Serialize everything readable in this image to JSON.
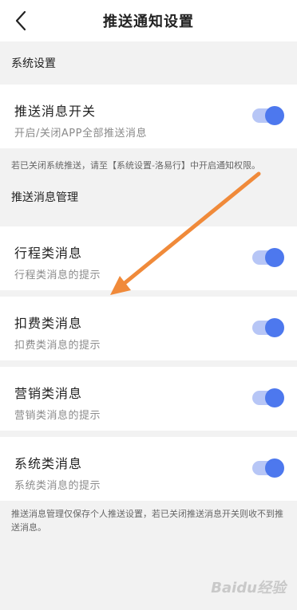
{
  "header": {
    "title": "推送通知设置",
    "back_icon": "back-chevron-icon"
  },
  "system_section": {
    "title": "系统设置",
    "item": {
      "name": "推送消息开关",
      "desc": "开启/关闭APP全部推送消息",
      "enabled": true
    },
    "note": "若已关闭系统推送，请至【系统设置-洛易行】中开启通知权限。"
  },
  "manage_section": {
    "title": "推送消息管理",
    "items": [
      {
        "name": "行程类消息",
        "desc": "行程类消息的提示",
        "enabled": true
      },
      {
        "name": "扣费类消息",
        "desc": "扣费类消息的提示",
        "enabled": true
      },
      {
        "name": "营销类消息",
        "desc": "营销类消息的提示",
        "enabled": true
      },
      {
        "name": "系统类消息",
        "desc": "系统类消息的提示",
        "enabled": true
      }
    ],
    "note": "推送消息管理仅保存个人推送设置，若已关闭推送消息开关则收不到推送消息。"
  },
  "colors": {
    "toggle_on": "#4d78ee",
    "toggle_track": "#b7c6f6",
    "annotation_arrow": "#f08a3a"
  },
  "watermark": "Baidu经验"
}
